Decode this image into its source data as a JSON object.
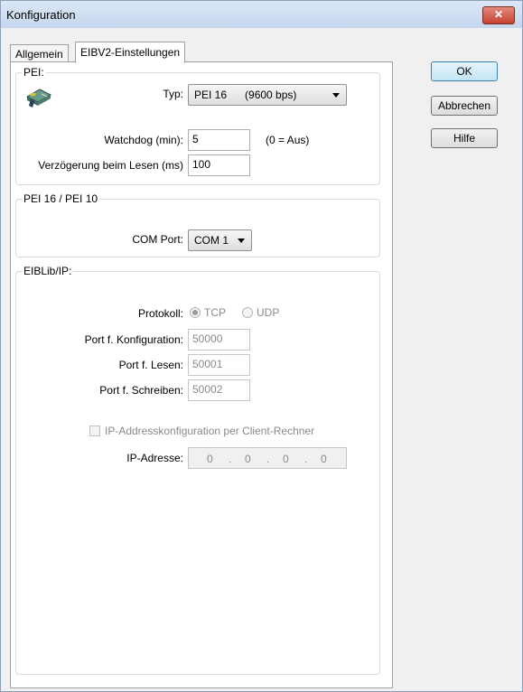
{
  "window": {
    "title": "Konfiguration",
    "close_glyph": "✕"
  },
  "tabs": [
    {
      "label": "Allgemein",
      "active": false
    },
    {
      "label": "EIBV2-Einstellungen",
      "active": true
    }
  ],
  "pei": {
    "legend": "PEI:",
    "icon": "pei-device-icon",
    "typ_label": "Typ:",
    "typ_value": "PEI 16      (9600 bps)",
    "watchdog_label": "Watchdog (min):",
    "watchdog_value": "5",
    "watchdog_hint": "(0 = Aus)",
    "delay_label": "Verzögerung beim Lesen (ms)",
    "delay_value": "100"
  },
  "pei16": {
    "legend": "PEI 16 / PEI 10",
    "com_label": "COM Port:",
    "com_value": "COM 1"
  },
  "eiblib": {
    "legend": "EIBLib/IP:",
    "protocol_label": "Protokoll:",
    "protocol_options": [
      "TCP",
      "UDP"
    ],
    "protocol_selected": "TCP",
    "port_config_label": "Port f. Konfiguration:",
    "port_config_value": "50000",
    "port_read_label": "Port f. Lesen:",
    "port_read_value": "50001",
    "port_write_label": "Port f. Schreiben:",
    "port_write_value": "50002",
    "client_config_label": "IP-Addresskonfiguration per Client-Rechner",
    "ip_label": "IP-Adresse:",
    "ip_octets": [
      "0",
      "0",
      "0",
      "0"
    ],
    "ip_dot": "."
  },
  "buttons": {
    "ok": "OK",
    "cancel": "Abbrechen",
    "help": "Hilfe"
  }
}
